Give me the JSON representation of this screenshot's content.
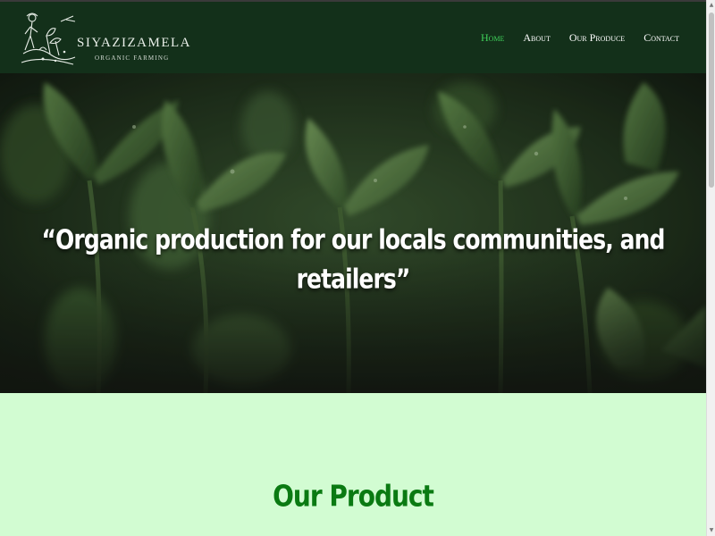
{
  "brand": {
    "name": "SIYAZIZAMELA",
    "tagline": "ORGANIC FARMING",
    "logo_icon": "farmer-with-plants-logo"
  },
  "nav": {
    "items": [
      {
        "label": "Home",
        "active": true
      },
      {
        "label": "About",
        "active": false
      },
      {
        "label": "Our Produce",
        "active": false
      },
      {
        "label": "Contact",
        "active": false
      }
    ]
  },
  "hero": {
    "quote": "“Organic production for our locals communities, and retailers”",
    "background": "seedlings-photo"
  },
  "products": {
    "title": "Our Product"
  },
  "colors": {
    "navbar_bg": "#13301a",
    "nav_active": "#3fd15a",
    "section_bg": "#d2fcd2",
    "section_title": "#0a7a12"
  }
}
